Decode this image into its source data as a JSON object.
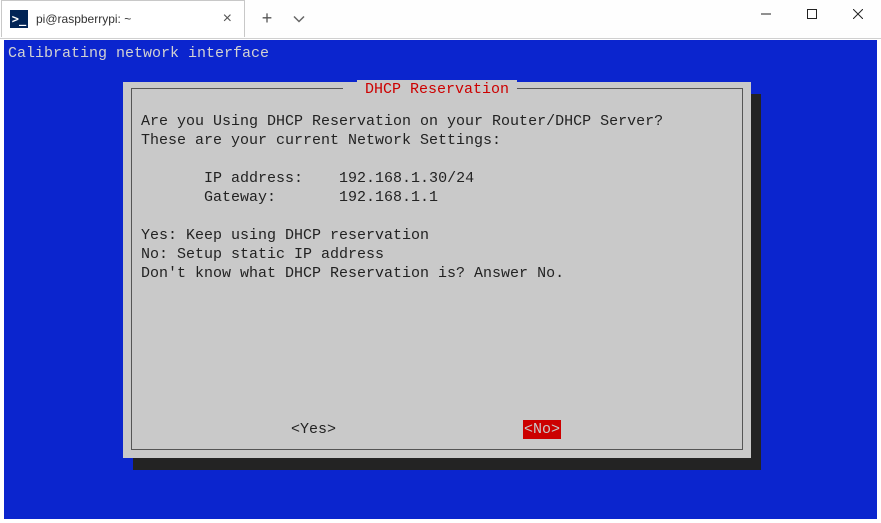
{
  "window": {
    "tab_title": "pi@raspberrypi: ~"
  },
  "terminal": {
    "status_line": "Calibrating network interface"
  },
  "dialog": {
    "title": "DHCP Reservation",
    "line1": "Are you Using DHCP Reservation on your Router/DHCP Server?",
    "line2": "These are your current Network Settings:",
    "ip_label": "       IP address:    ",
    "ip_value": "192.168.1.30/24",
    "gw_label": "       Gateway:       ",
    "gw_value": "192.168.1.1",
    "opt_yes": "Yes: Keep using DHCP reservation",
    "opt_no": "No: Setup static IP address",
    "opt_hint": "Don't know what DHCP Reservation is? Answer No.",
    "btn_yes": "<Yes>",
    "btn_no": "<No>"
  }
}
